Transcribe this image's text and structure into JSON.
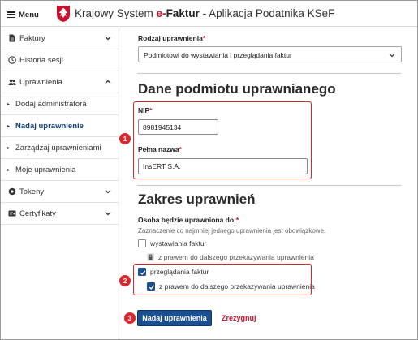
{
  "header": {
    "menu_label": "Menu",
    "title_prefix": "Krajowy System",
    "title_efaktur_e": "e-",
    "title_efaktur_rest": "Faktur",
    "title_suffix": " - Aplikacja Podatnika KSeF"
  },
  "sidebar": {
    "items": [
      {
        "label": "Faktury",
        "icon": "document-icon",
        "chevron": "down"
      },
      {
        "label": "Historia sesji",
        "icon": "clock-icon"
      },
      {
        "label": "Uprawnienia",
        "icon": "users-icon",
        "chevron": "up"
      },
      {
        "label": "Dodaj administratora"
      },
      {
        "label": "Nadaj uprawnienie",
        "active": true
      },
      {
        "label": "Zarządzaj uprawnieniami"
      },
      {
        "label": "Moje uprawnienia"
      },
      {
        "label": "Tokeny",
        "icon": "token-icon",
        "chevron": "down"
      },
      {
        "label": "Certyfikaty",
        "icon": "certificate-icon",
        "chevron": "down"
      }
    ]
  },
  "form": {
    "rodzaj_label": "Rodzaj uprawnienia",
    "rodzaj_value": "Podmiotowi do wystawiania i przeglądania faktur",
    "section1_title": "Dane podmiotu uprawnianego",
    "nip_label": "NIP",
    "nip_value": "8981945134",
    "nazwa_label": "Pełna nazwa",
    "nazwa_value": "InsERT S.A.",
    "section2_title": "Zakres uprawnień",
    "osoba_label": "Osoba będzie uprawniona do:",
    "hint": "Zaznaczenie co najmniej jednego uprawnienia jest obowiązkowe.",
    "opt1_label": "wystawiania faktur",
    "opt1_checked": false,
    "opt1_sub_label": "z prawem do dalszego przekazywania uprawnienia",
    "opt2_label": "przeglądania faktur",
    "opt2_checked": true,
    "opt2_sub_label": "z prawem do dalszego przekazywania uprawnienia",
    "opt2_sub_checked": true,
    "required_mark": "*"
  },
  "buttons": {
    "submit_label": "Nadaj uprawnienia",
    "cancel_label": "Zrezygnuj"
  },
  "callouts": [
    "1",
    "2",
    "3"
  ],
  "colors": {
    "primary": "#1b4f8f",
    "accent_red": "#c8102e",
    "callout_red": "#d9272e"
  }
}
